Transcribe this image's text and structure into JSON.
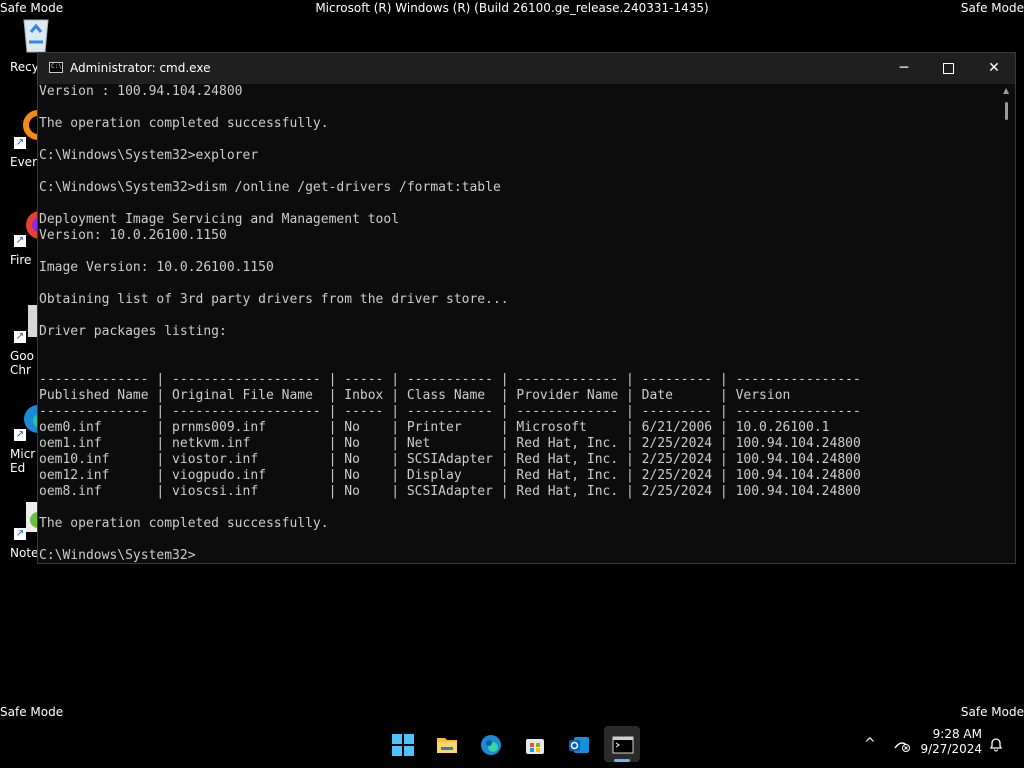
{
  "desktop": {
    "safe_mode": "Safe Mode",
    "build_title": "Microsoft (R) Windows (R) (Build 26100.ge_release.240331-1435)",
    "icons": [
      {
        "label": "Recyc",
        "icon": "recycle-bin-icon"
      },
      {
        "label": "Every",
        "icon": "everything-search-icon"
      },
      {
        "label": "Fire",
        "icon": "firefox-icon"
      },
      {
        "label": "Goo\nChr",
        "icon": "chrome-icon"
      },
      {
        "label": "Micr\nEd",
        "icon": "edge-icon"
      },
      {
        "label": "Notep",
        "icon": "notepad-plus-plus-icon"
      }
    ]
  },
  "window": {
    "title": "Administrator: cmd.exe",
    "minimize_glyph": "─",
    "close_glyph": "✕"
  },
  "console": {
    "lines": [
      "Version : 100.94.104.24800",
      "",
      "The operation completed successfully.",
      "",
      "C:\\Windows\\System32>explorer",
      "",
      "C:\\Windows\\System32>dism /online /get-drivers /format:table",
      "",
      "Deployment Image Servicing and Management tool",
      "Version: 10.0.26100.1150",
      "",
      "Image Version: 10.0.26100.1150",
      "",
      "Obtaining list of 3rd party drivers from the driver store...",
      "",
      "Driver packages listing:",
      "",
      "",
      "-------------- | ------------------- | ----- | ----------- | ------------- | --------- | ----------------",
      "Published Name | Original File Name  | Inbox | Class Name  | Provider Name | Date      | Version",
      "-------------- | ------------------- | ----- | ----------- | ------------- | --------- | ----------------",
      "oem0.inf       | prnms009.inf        | No    | Printer     | Microsoft     | 6/21/2006 | 10.0.26100.1",
      "oem1.inf       | netkvm.inf          | No    | Net         | Red Hat, Inc. | 2/25/2024 | 100.94.104.24800",
      "oem10.inf      | viostor.inf         | No    | SCSIAdapter | Red Hat, Inc. | 2/25/2024 | 100.94.104.24800",
      "oem12.inf      | viogpudo.inf        | No    | Display     | Red Hat, Inc. | 2/25/2024 | 100.94.104.24800",
      "oem8.inf       | vioscsi.inf         | No    | SCSIAdapter | Red Hat, Inc. | 2/25/2024 | 100.94.104.24800",
      "",
      "The operation completed successfully.",
      "",
      "C:\\Windows\\System32>"
    ]
  },
  "taskbar": {
    "apps": [
      {
        "name": "start-button",
        "icon": "windows-logo-icon"
      },
      {
        "name": "file-explorer-button",
        "icon": "folder-icon"
      },
      {
        "name": "edge-button",
        "icon": "edge-icon"
      },
      {
        "name": "store-button",
        "icon": "store-icon"
      },
      {
        "name": "outlook-button",
        "icon": "outlook-icon"
      },
      {
        "name": "cmd-button",
        "icon": "terminal-icon"
      }
    ],
    "tray_chevron": "^",
    "time": "9:28 AM",
    "date": "9/27/2024"
  },
  "colors": {
    "console_bg": "#0c0c0c",
    "console_text": "#cccccc",
    "titlebar": "#1f1f1f",
    "accent": "#4cc2ff"
  }
}
